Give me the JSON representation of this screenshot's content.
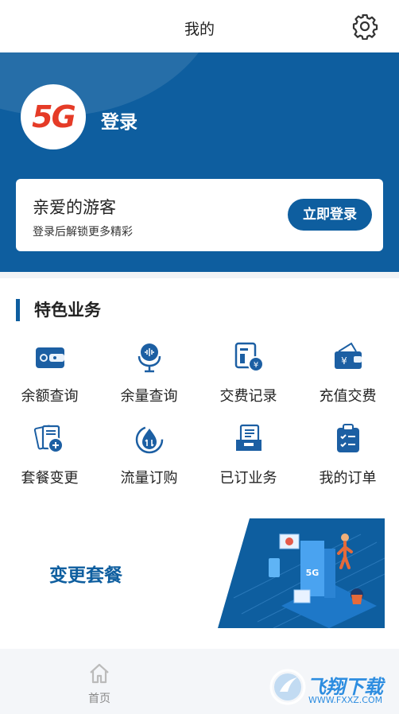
{
  "header": {
    "title": "我的",
    "settings_icon": "gear-icon"
  },
  "profile": {
    "avatar_text": "5G",
    "login_label": "登录",
    "accent_color": "#0e5e9f",
    "logo_color": "#e53b27"
  },
  "guest_card": {
    "greeting": "亲爱的游客",
    "subtitle": "登录后解锁更多精彩",
    "login_button": "立即登录"
  },
  "services": {
    "title": "特色业务",
    "items": [
      {
        "label": "余额查询",
        "icon": "wallet-icon"
      },
      {
        "label": "余量查询",
        "icon": "microphone-icon"
      },
      {
        "label": "交费记录",
        "icon": "bill-icon"
      },
      {
        "label": "充值交费",
        "icon": "yuan-wallet-icon"
      },
      {
        "label": "套餐变更",
        "icon": "package-icon"
      },
      {
        "label": "流量订购",
        "icon": "data-drop-icon"
      },
      {
        "label": "已订业务",
        "icon": "subscription-icon"
      },
      {
        "label": "我的订单",
        "icon": "clipboard-icon"
      }
    ]
  },
  "banner": {
    "title": "变更套餐",
    "art_badge": "5G"
  },
  "tabbar": {
    "home_label": "首页"
  },
  "watermark": {
    "text": "飞翔下载",
    "url": "WWW.FXXZ.COM"
  }
}
